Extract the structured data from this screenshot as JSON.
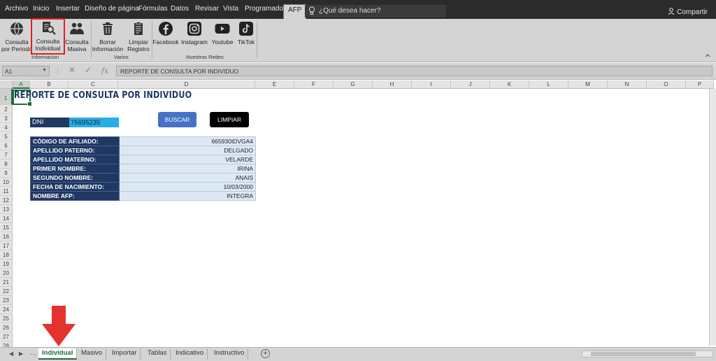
{
  "ribbon_tabs": [
    "Archivo",
    "Inicio",
    "Insertar",
    "Diseño de página",
    "Fórmulas",
    "Datos",
    "Revisar",
    "Vista",
    "Programador",
    "AFP"
  ],
  "active_tab": "AFP",
  "tellme_placeholder": "¿Qué desea hacer?",
  "share_label": "Compartir",
  "ribbon": {
    "buttons": [
      {
        "line1": "Consulta",
        "line2": "por Periodo",
        "icon": "globe-icon"
      },
      {
        "line1": "Consulta",
        "line2": "Individual",
        "icon": "document-search-icon"
      },
      {
        "line1": "Consulta",
        "line2": "Masiva",
        "icon": "users-icon"
      },
      {
        "line1": "Borrar",
        "line2": "Información",
        "icon": "trash-icon"
      },
      {
        "line1": "Limpiar",
        "line2": "Registro",
        "icon": "clipboard-icon"
      },
      {
        "line1": "Facebook",
        "line2": "",
        "icon": "facebook-icon"
      },
      {
        "line1": "Instagram",
        "line2": "",
        "icon": "instagram-icon"
      },
      {
        "line1": "Youtube",
        "line2": "",
        "icon": "youtube-icon"
      },
      {
        "line1": "TikTok",
        "line2": "",
        "icon": "tiktok-icon"
      }
    ],
    "groups": {
      "informacion": "Informacion",
      "varios": "Varios",
      "redes": "Nuestras Redes"
    }
  },
  "formula_bar": {
    "cell_ref": "A1",
    "content": "REPORTE DE CONSULTA POR INDIVIDUO"
  },
  "columns": [
    "A",
    "B",
    "C",
    "D",
    "E",
    "F",
    "G",
    "H",
    "I",
    "J",
    "K",
    "L",
    "M",
    "N",
    "O",
    "P"
  ],
  "rows": [
    "1",
    "2",
    "3",
    "4",
    "5",
    "6",
    "7",
    "8",
    "9",
    "10",
    "11",
    "12",
    "13",
    "14",
    "15",
    "16",
    "17",
    "18",
    "19",
    "20",
    "21",
    "22",
    "23",
    "24",
    "25",
    "26",
    "27",
    "28"
  ],
  "sheet": {
    "title": "REPORTE DE CONSULTA POR INDIVIDUO",
    "dni_label": "DNI",
    "dni_value": "75695235",
    "buscar_label": "BUSCAR",
    "limpiar_label": "LIMPIAR",
    "fields": [
      {
        "label": "CÓDIGO DE AFILIADO:",
        "value": "665930IDVGA4"
      },
      {
        "label": "APELLIDO PATERNO:",
        "value": "DELGADO"
      },
      {
        "label": "APELLIDO MATERNO:",
        "value": "VELARDE"
      },
      {
        "label": "PRIMER NOMBRE:",
        "value": "IRINA"
      },
      {
        "label": "SEGUNDO NOMBRE:",
        "value": "ANAIS"
      },
      {
        "label": "FECHA DE NACIMIENTO:",
        "value": "10/03/2000"
      },
      {
        "label": "NOMBRE AFP:",
        "value": "INTEGRA"
      }
    ]
  },
  "sheet_tabs": [
    "Individual",
    "Masivo",
    "Importar",
    "Tablas",
    "Indicativo",
    "Instructivo"
  ],
  "active_sheet": "Individual",
  "colors": {
    "navy": "#1f3864",
    "cyan": "#27aee8",
    "blue_button": "#4472c4",
    "excel_green": "#1d6b3a",
    "arrow_red": "#e5322d"
  }
}
